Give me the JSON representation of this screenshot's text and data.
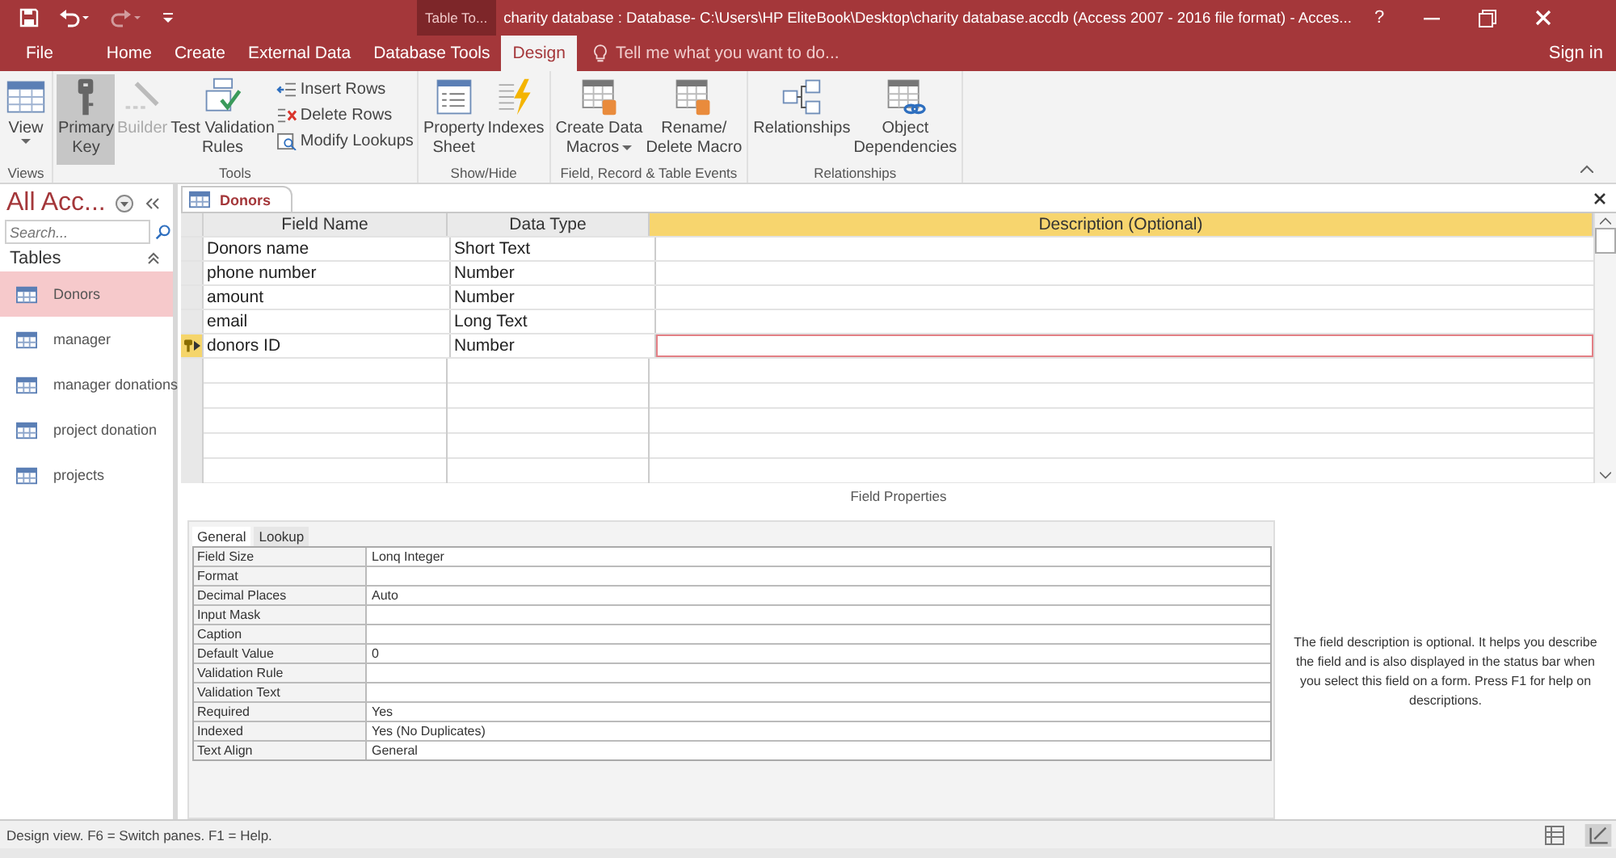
{
  "title_bar": {
    "contextual_tab": "Table To...",
    "title": "charity database : Database- C:\\Users\\HP EliteBook\\Desktop\\charity database.accdb (Access 2007 - 2016 file format) - Acces...",
    "help": "?"
  },
  "ribbon_tabs": [
    {
      "label": "File",
      "selected": false
    },
    {
      "label": "Home",
      "selected": false
    },
    {
      "label": "Create",
      "selected": false
    },
    {
      "label": "External Data",
      "selected": false
    },
    {
      "label": "Database Tools",
      "selected": false
    },
    {
      "label": "Design",
      "selected": true
    }
  ],
  "tell_me": {
    "placeholder": "Tell me what you want to do..."
  },
  "sign_in": "Sign in",
  "ribbon_groups": [
    {
      "label": "Views",
      "buttons": [
        {
          "kind": "large",
          "lines": [
            "View"
          ],
          "dropdown": true,
          "selected": false,
          "disabled": false
        }
      ]
    },
    {
      "label": "Tools",
      "buttons": [
        {
          "kind": "large",
          "lines": [
            "Primary",
            "Key"
          ],
          "dropdown": false,
          "selected": true,
          "disabled": false
        },
        {
          "kind": "large",
          "lines": [
            "Builder"
          ],
          "dropdown": false,
          "selected": false,
          "disabled": true
        },
        {
          "kind": "large",
          "lines": [
            "Test Validation",
            "Rules"
          ],
          "dropdown": false,
          "selected": false,
          "disabled": false
        },
        {
          "kind": "small",
          "lines": [
            "Insert Rows"
          ],
          "dropdown": false,
          "selected": false,
          "disabled": false
        },
        {
          "kind": "small",
          "lines": [
            "Delete Rows"
          ],
          "dropdown": false,
          "selected": false,
          "disabled": false
        },
        {
          "kind": "small",
          "lines": [
            "Modify Lookups"
          ],
          "dropdown": false,
          "selected": false,
          "disabled": false
        }
      ]
    },
    {
      "label": "Show/Hide",
      "buttons": [
        {
          "kind": "large",
          "lines": [
            "Property",
            "Sheet"
          ],
          "dropdown": false,
          "selected": false,
          "disabled": false
        },
        {
          "kind": "large",
          "lines": [
            "Indexes"
          ],
          "dropdown": false,
          "selected": false,
          "disabled": false
        }
      ]
    },
    {
      "label": "Field, Record & Table Events",
      "buttons": [
        {
          "kind": "large",
          "lines": [
            "Create Data",
            "Macros"
          ],
          "dropdown": true,
          "selected": false,
          "disabled": false
        },
        {
          "kind": "large",
          "lines": [
            "Rename/",
            "Delete Macro"
          ],
          "dropdown": false,
          "selected": false,
          "disabled": false
        }
      ]
    },
    {
      "label": "Relationships",
      "buttons": [
        {
          "kind": "large",
          "lines": [
            "Relationships"
          ],
          "dropdown": false,
          "selected": false,
          "disabled": false
        },
        {
          "kind": "large",
          "lines": [
            "Object",
            "Dependencies"
          ],
          "dropdown": false,
          "selected": false,
          "disabled": false
        }
      ]
    }
  ],
  "nav": {
    "title": "All Acc...",
    "search": {
      "placeholder": "Search..."
    },
    "group": "Tables",
    "items": [
      {
        "label": "Donors",
        "selected": true
      },
      {
        "label": "manager",
        "selected": false
      },
      {
        "label": "manager donations",
        "selected": false
      },
      {
        "label": "project donation",
        "selected": false
      },
      {
        "label": "projects",
        "selected": false
      }
    ]
  },
  "document_tab": "Donors",
  "design_grid": {
    "columns": [
      "Field Name",
      "Data Type",
      "Description (Optional)"
    ],
    "rows": [
      {
        "field_name": "Donors name",
        "data_type": "Short Text",
        "primary_key": false,
        "selected": false
      },
      {
        "field_name": "phone number",
        "data_type": "Number",
        "primary_key": false,
        "selected": false
      },
      {
        "field_name": "amount",
        "data_type": "Number",
        "primary_key": false,
        "selected": false
      },
      {
        "field_name": "email",
        "data_type": "Long Text",
        "primary_key": false,
        "selected": false
      },
      {
        "field_name": "donors ID",
        "data_type": "Number",
        "primary_key": true,
        "selected": true
      }
    ]
  },
  "field_properties": {
    "title": "Field Properties",
    "tabs": [
      {
        "label": "General",
        "selected": true
      },
      {
        "label": "Lookup",
        "selected": false
      }
    ],
    "properties": [
      {
        "name": "Field Size",
        "value": "Lonq Integer"
      },
      {
        "name": "Format"
      },
      {
        "name": "Decimal Places",
        "value": "Auto"
      },
      {
        "name": "Input Mask"
      },
      {
        "name": "Caption"
      },
      {
        "name": "Default Value",
        "value": "0"
      },
      {
        "name": "Validation Rule"
      },
      {
        "name": "Validation Text"
      },
      {
        "name": "Required",
        "value": "Yes"
      },
      {
        "name": "Indexed",
        "value": "Yes (No Duplicates)"
      },
      {
        "name": "Text Align",
        "value": "General"
      }
    ],
    "help_text": "The field description is optional. It helps you describe the field and is also displayed in the status bar when you select this field on a form. Press F1 for help on descriptions."
  },
  "status_bar": {
    "text": "Design view.  F6 = Switch panes.  F1 = Help."
  }
}
